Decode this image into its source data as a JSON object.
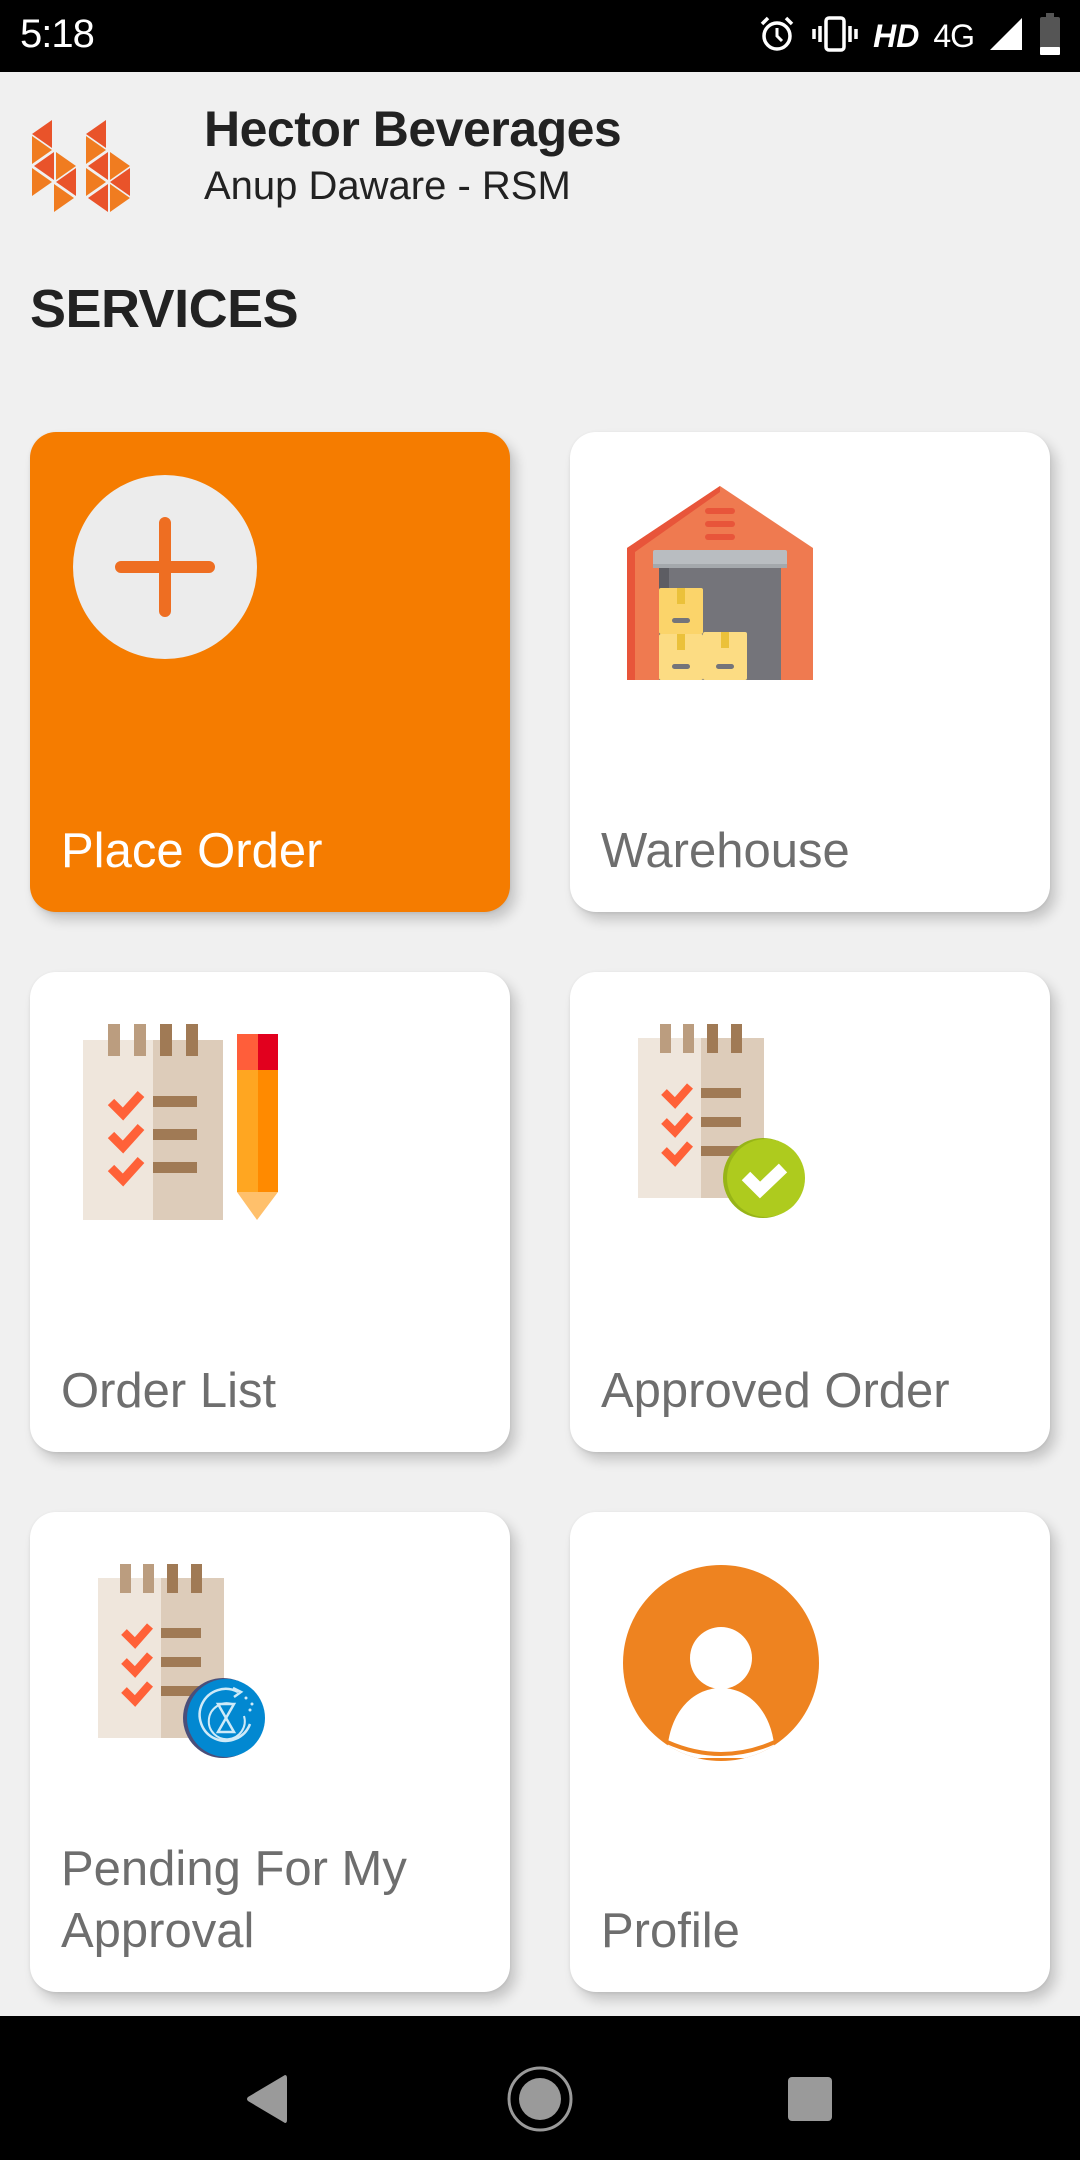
{
  "status_bar": {
    "time": "5:18",
    "icons": [
      "alarm-icon",
      "vibrate-icon",
      "hd-icon",
      "4g-icon",
      "signal-icon",
      "battery-icon"
    ],
    "hd_label": "HD",
    "network_label": "4G"
  },
  "header": {
    "company_name": "Hector Beverages",
    "user_role": "Anup Daware - RSM",
    "logo_icon": "hector-logo-icon"
  },
  "section_title": "SERVICES",
  "colors": {
    "accent": "#f57c00",
    "logo_orange": "#f07c20",
    "logo_red": "#e9532a",
    "approved_green": "#a8c81c",
    "pending_blue": "#0288d1",
    "profile_orange": "#ee8320"
  },
  "services": [
    {
      "label": "Place Order",
      "icon": "add-circle-icon",
      "highlighted": true
    },
    {
      "label": "Warehouse",
      "icon": "warehouse-icon",
      "highlighted": false
    },
    {
      "label": "Order List",
      "icon": "checklist-pencil-icon",
      "highlighted": false
    },
    {
      "label": "Approved Order",
      "icon": "checklist-approved-icon",
      "highlighted": false
    },
    {
      "label": "Pending For My Approval",
      "icon": "checklist-pending-icon",
      "highlighted": false
    },
    {
      "label": "Profile",
      "icon": "user-profile-icon",
      "highlighted": false
    }
  ],
  "nav_bar": {
    "buttons": [
      "back-icon",
      "home-icon",
      "recents-icon"
    ]
  }
}
